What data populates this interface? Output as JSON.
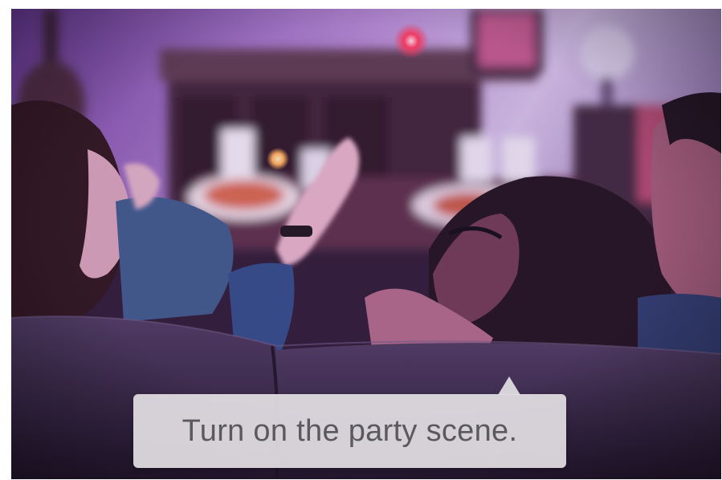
{
  "voice_prompt": {
    "text": "Turn on the party scene."
  },
  "colors": {
    "ambient_purple": "#7b3fa0",
    "wall_lavender": "#c9a8e0",
    "couch_dark": "#2a1e3a",
    "bubble_bg": "#e2dfe3",
    "bubble_text": "#5a5a5e"
  }
}
